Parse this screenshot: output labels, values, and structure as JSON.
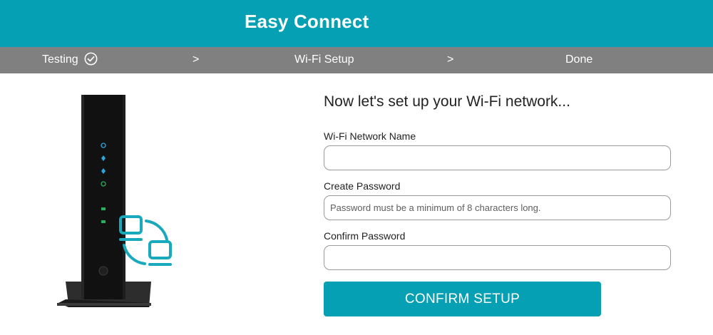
{
  "header": {
    "title": "Easy Connect"
  },
  "steps": {
    "items": [
      {
        "label": "Testing"
      },
      {
        "label": ">"
      },
      {
        "label": "Wi-Fi Setup"
      },
      {
        "label": ">"
      },
      {
        "label": "Done"
      }
    ]
  },
  "form": {
    "heading": "Now let's set up your Wi-Fi network...",
    "network_name": {
      "label": "Wi-Fi Network Name",
      "placeholder": ""
    },
    "password": {
      "label": "Create Password",
      "placeholder": "Password must be a minimum of 8 characters long."
    },
    "confirm_password": {
      "label": "Confirm Password",
      "placeholder": ""
    },
    "confirm_button": "CONFIRM SETUP"
  },
  "colors": {
    "brand": "#06a0b4",
    "steps_bar": "#808080",
    "device_body": "#111111",
    "led_blue": "#2aa8e0",
    "led_green": "#25b05a"
  },
  "icons": {
    "completed": "check-circle-icon",
    "device": "cable-modem-router-image",
    "connection": "devices-connection-icon"
  }
}
